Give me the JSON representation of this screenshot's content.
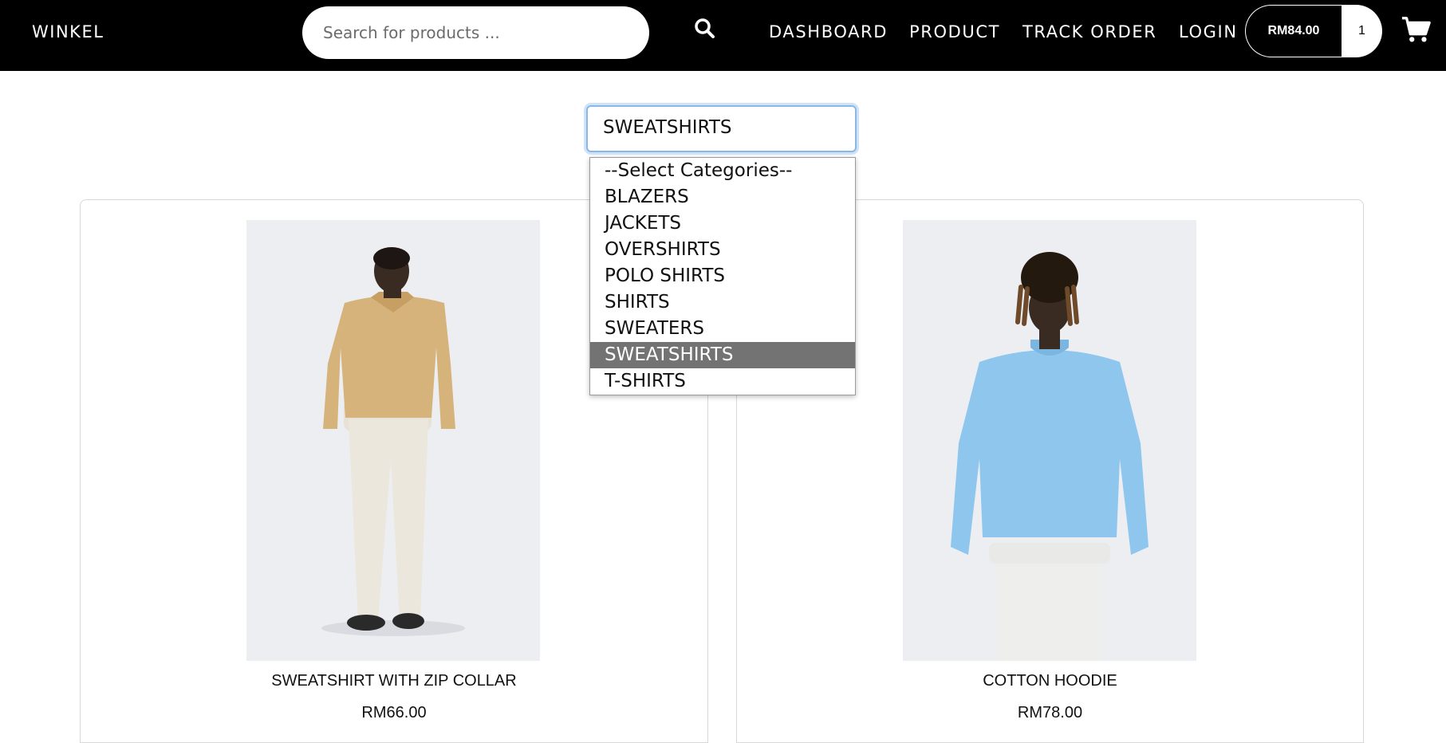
{
  "navbar": {
    "brand": "WINKEL",
    "search_placeholder": "Search for products ...",
    "links": [
      "DASHBOARD",
      "PRODUCT",
      "TRACK ORDER",
      "LOGIN"
    ],
    "cart_amount": "RM84.00",
    "cart_count": "1"
  },
  "category_select": {
    "value": "SWEATSHIRTS",
    "options": [
      "--Select Categories--",
      "BLAZERS",
      "JACKETS",
      "OVERSHIRTS",
      "POLO SHIRTS",
      "SHIRTS",
      "SWEATERS",
      "SWEATSHIRTS",
      "T-SHIRTS"
    ],
    "highlighted": "SWEATSHIRTS"
  },
  "products": [
    {
      "name": "SWEATSHIRT WITH ZIP COLLAR",
      "price": "RM66.00",
      "image": "man-in-beige-polo-sweatshirt"
    },
    {
      "name": "COTTON HOODIE",
      "price": "RM78.00",
      "image": "man-in-light-blue-sweatshirt"
    }
  ],
  "colors": {
    "navbar": "#000000",
    "highlight": "#737373",
    "focus_ring": "#8ab8e6"
  },
  "icons": [
    "search-icon",
    "cart-icon"
  ]
}
